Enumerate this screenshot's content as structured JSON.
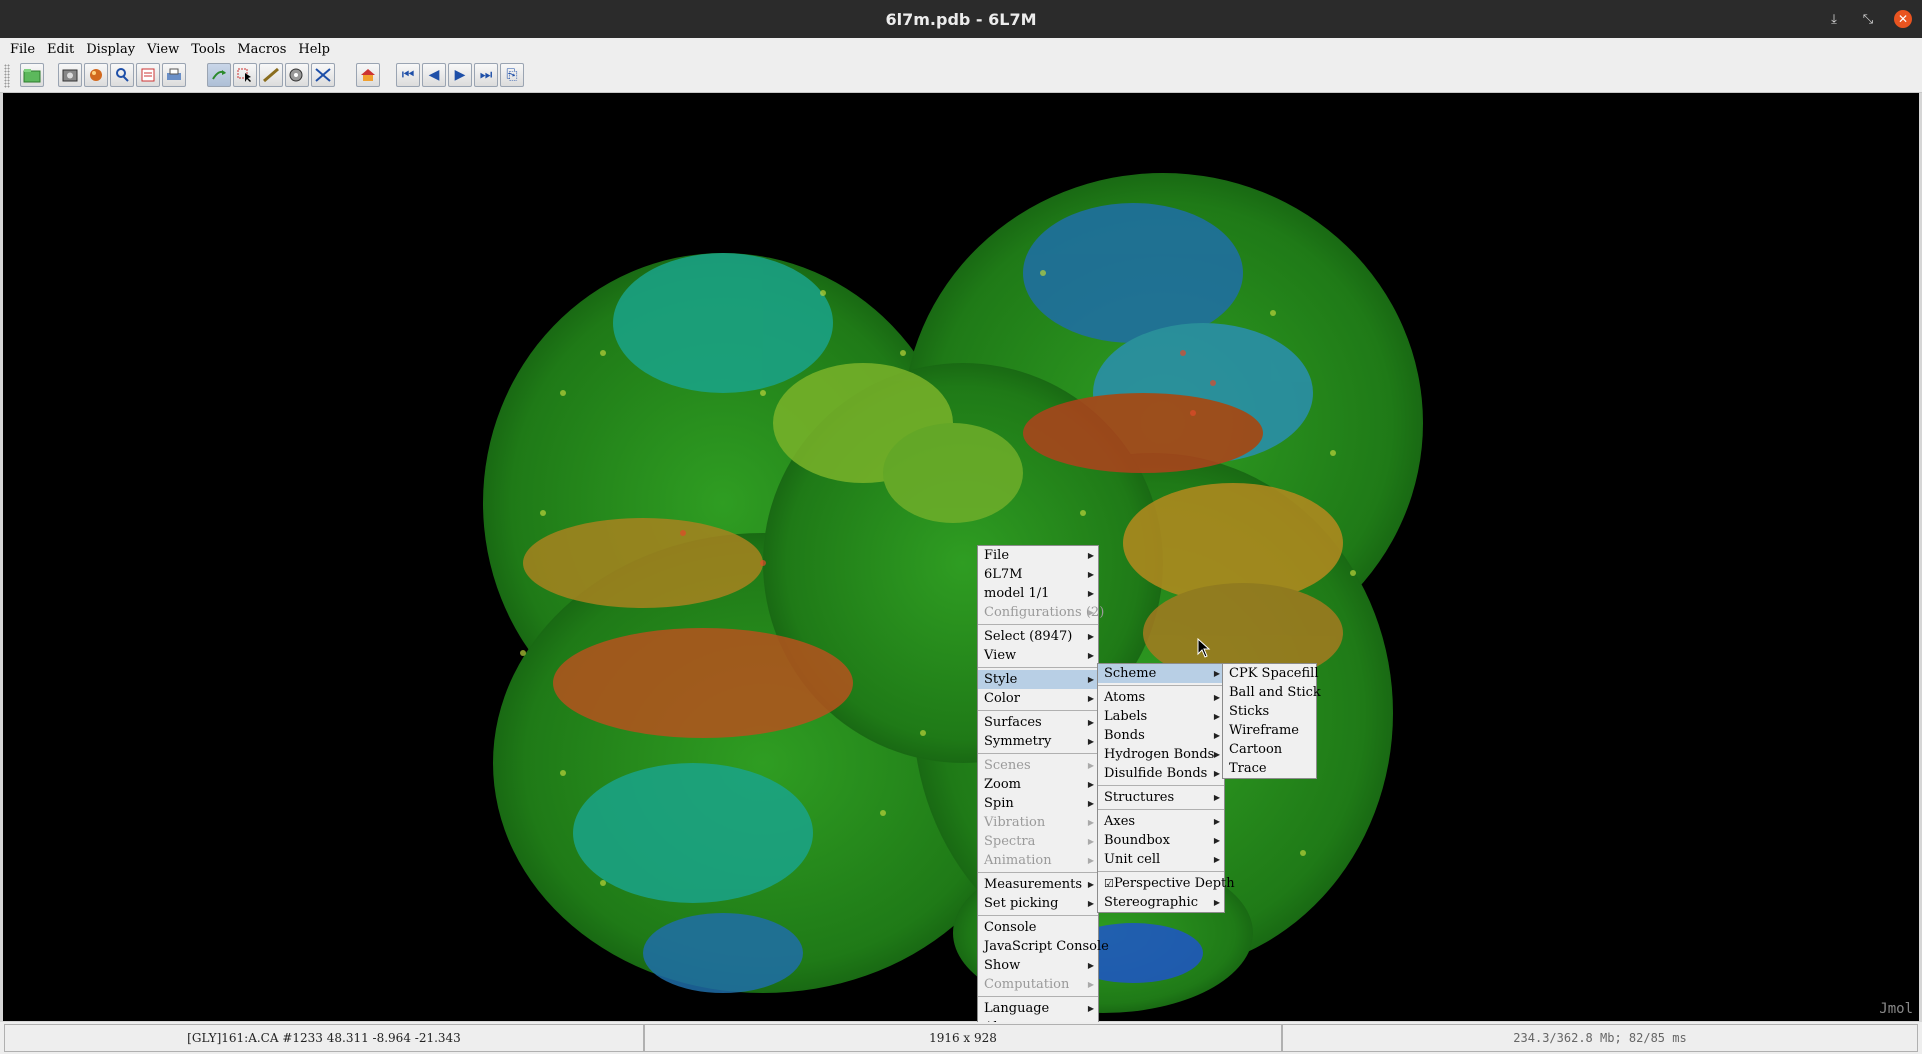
{
  "window": {
    "title": "6l7m.pdb - 6L7M",
    "controls": [
      "minimize-icon",
      "maximize-icon",
      "close-icon"
    ]
  },
  "menubar": {
    "items": [
      "File",
      "Edit",
      "Display",
      "View",
      "Tools",
      "Macros",
      "Help"
    ]
  },
  "toolbar": {
    "icons": [
      "open-file-icon",
      "export-image-icon",
      "render-icon",
      "zoom-icon",
      "script-editor-icon",
      "print-icon",
      "rotate-icon",
      "select-icon",
      "measure-icon",
      "pick-center-icon",
      "dimensions-icon",
      "home-icon",
      "first-frame-icon",
      "previous-frame-icon",
      "next-frame-icon",
      "last-frame-icon",
      "copy-icon"
    ]
  },
  "viewer": {
    "watermark": "Jmol",
    "background": "#000000"
  },
  "status": {
    "atom_info": "[GLY]161:A.CA #1233 48.311 -8.964 -21.343",
    "dimensions": "1916 x 928",
    "memory": "234.3/362.8 Mb;  82/85 ms"
  },
  "popup_main": {
    "items": [
      {
        "label": "File",
        "submenu": true,
        "disabled": false
      },
      {
        "label": "6L7M",
        "submenu": true,
        "disabled": false
      },
      {
        "label": "model 1/1",
        "submenu": true,
        "disabled": false
      },
      {
        "label": "Configurations (2)",
        "submenu": true,
        "disabled": true
      },
      {
        "sep": true
      },
      {
        "label": "Select (8947)",
        "submenu": true,
        "disabled": false
      },
      {
        "label": "View",
        "submenu": true,
        "disabled": false
      },
      {
        "sep": true
      },
      {
        "label": "Style",
        "submenu": true,
        "disabled": false,
        "active": true
      },
      {
        "label": "Color",
        "submenu": true,
        "disabled": false
      },
      {
        "sep": true
      },
      {
        "label": "Surfaces",
        "submenu": true,
        "disabled": false
      },
      {
        "label": "Symmetry",
        "submenu": true,
        "disabled": false
      },
      {
        "sep": true
      },
      {
        "label": "Scenes",
        "submenu": true,
        "disabled": true
      },
      {
        "label": "Zoom",
        "submenu": true,
        "disabled": false
      },
      {
        "label": "Spin",
        "submenu": true,
        "disabled": false
      },
      {
        "label": "Vibration",
        "submenu": true,
        "disabled": true
      },
      {
        "label": "Spectra",
        "submenu": true,
        "disabled": true
      },
      {
        "label": "Animation",
        "submenu": true,
        "disabled": true
      },
      {
        "sep": true
      },
      {
        "label": "Measurements",
        "submenu": true,
        "disabled": false
      },
      {
        "label": "Set picking",
        "submenu": true,
        "disabled": false
      },
      {
        "sep": true
      },
      {
        "label": "Console",
        "submenu": false,
        "disabled": false
      },
      {
        "label": "JavaScript Console",
        "submenu": false,
        "disabled": false
      },
      {
        "label": "Show",
        "submenu": true,
        "disabled": false
      },
      {
        "label": "Computation",
        "submenu": true,
        "disabled": true
      },
      {
        "sep": true
      },
      {
        "label": "Language",
        "submenu": true,
        "disabled": false
      },
      {
        "label": "About...",
        "submenu": true,
        "disabled": false
      }
    ]
  },
  "popup_style": {
    "items": [
      {
        "label": "Scheme",
        "submenu": true,
        "active": true
      },
      {
        "sep": true
      },
      {
        "label": "Atoms",
        "submenu": true
      },
      {
        "label": "Labels",
        "submenu": true
      },
      {
        "label": "Bonds",
        "submenu": true
      },
      {
        "label": "Hydrogen Bonds",
        "submenu": true
      },
      {
        "label": "Disulfide Bonds",
        "submenu": true
      },
      {
        "sep": true
      },
      {
        "label": "Structures",
        "submenu": true
      },
      {
        "sep": true
      },
      {
        "label": "Axes",
        "submenu": true
      },
      {
        "label": "Boundbox",
        "submenu": true
      },
      {
        "label": "Unit cell",
        "submenu": true
      },
      {
        "sep": true
      },
      {
        "label": "Perspective Depth",
        "submenu": false,
        "checked": true
      },
      {
        "label": "Stereographic",
        "submenu": true
      }
    ]
  },
  "popup_scheme": {
    "items": [
      {
        "label": "CPK Spacefill"
      },
      {
        "label": "Ball and Stick"
      },
      {
        "label": "Sticks"
      },
      {
        "label": "Wireframe"
      },
      {
        "label": "Cartoon"
      },
      {
        "label": "Trace"
      }
    ]
  }
}
